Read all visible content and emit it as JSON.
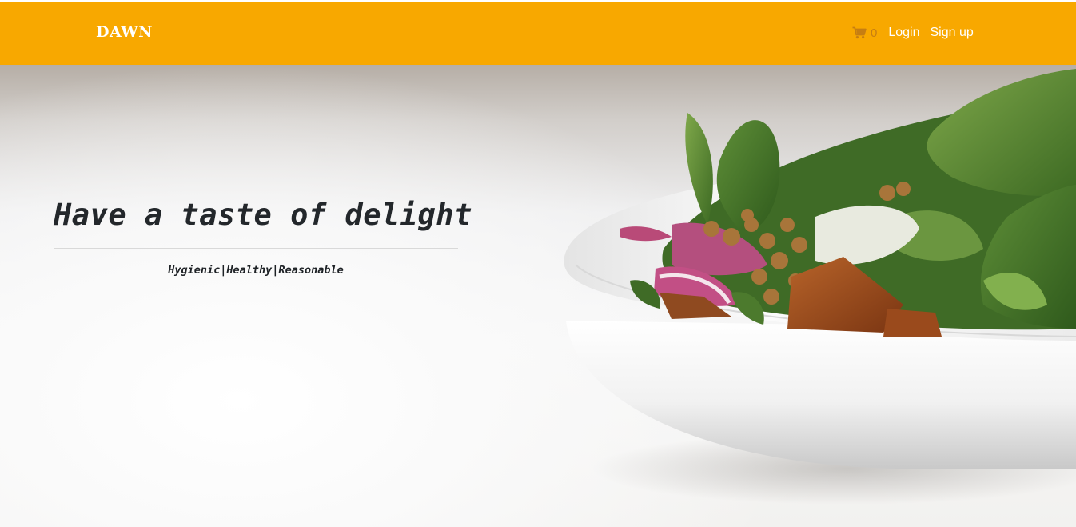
{
  "navbar": {
    "brand": "DAWN",
    "cart_count": "0",
    "login_label": "Login",
    "signup_label": "Sign up",
    "accent_color": "#f8a800"
  },
  "hero": {
    "headline": "Have a taste of delight",
    "tagline": "Hygienic|Healthy|Reasonable"
  },
  "icons": {
    "cart": "shopping-cart-icon"
  }
}
